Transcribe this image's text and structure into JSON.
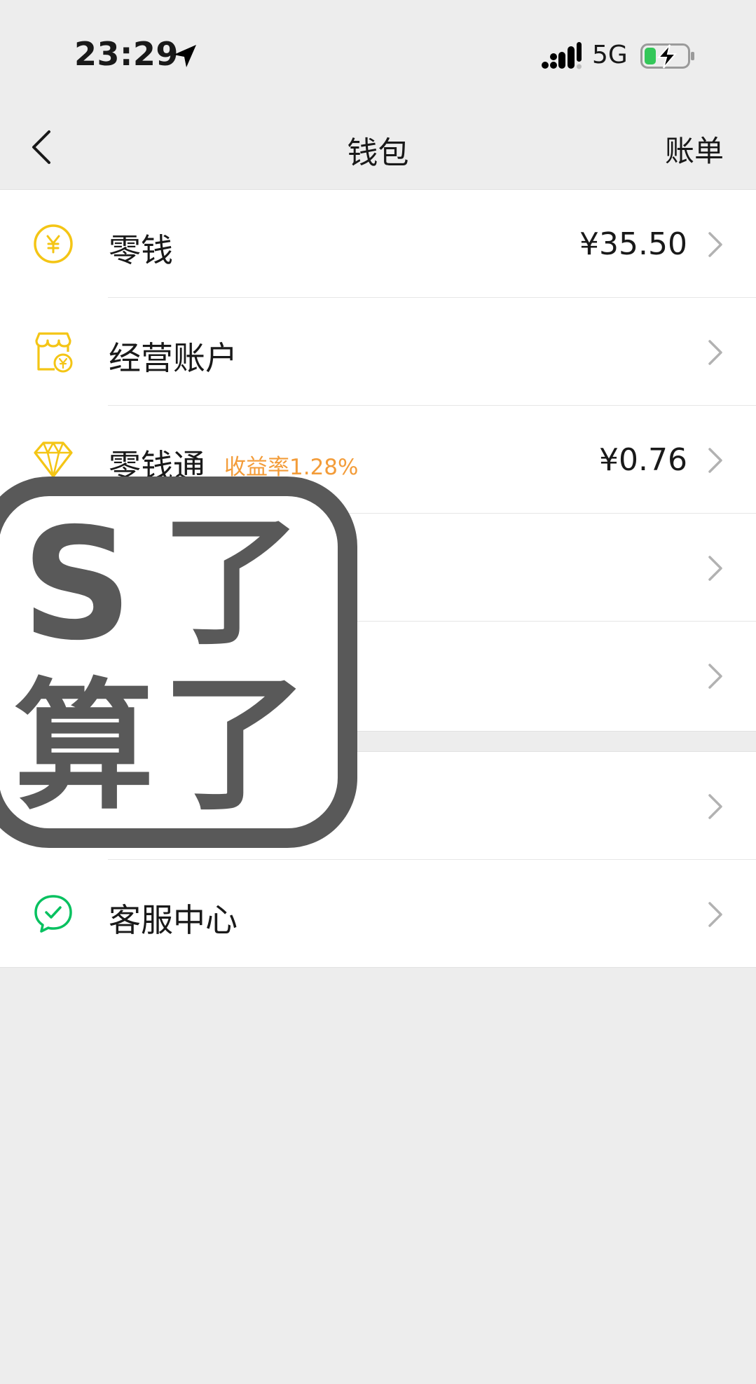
{
  "status_bar": {
    "time": "23:29",
    "network": "5G"
  },
  "nav": {
    "title": "钱包",
    "action": "账单"
  },
  "wallet_items": [
    {
      "label": "零钱",
      "value": "¥35.50",
      "badge": ""
    },
    {
      "label": "经营账户",
      "value": "",
      "badge": ""
    },
    {
      "label": "零钱通",
      "value": "¥0.76",
      "badge": "收益率1.28%"
    },
    {
      "label": "",
      "value": "",
      "badge": ""
    },
    {
      "label": "",
      "value": "",
      "badge": ""
    }
  ],
  "service_items": [
    {
      "label": ""
    },
    {
      "label": "客服中心"
    }
  ],
  "watermark": {
    "text_1": "S",
    "text_2": "了",
    "text_3": "算",
    "text_4": "了"
  },
  "colors": {
    "accent_yellow": "#f4c515",
    "accent_green": "#07c160",
    "badge_orange": "#f39c39",
    "watermark_gray": "#595959"
  },
  "icons": {
    "row_1": "yuan-coin-icon",
    "row_2": "store-account-icon",
    "row_3": "diamond-icon",
    "service_2": "customer-service-chat-icon"
  }
}
